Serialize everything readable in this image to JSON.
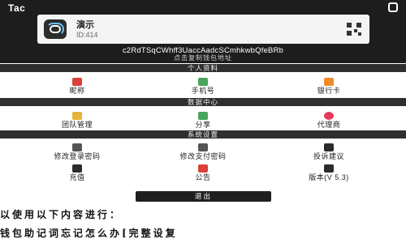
{
  "app": {
    "brand": "Tac"
  },
  "profile": {
    "name": "演示",
    "id": "ID:414",
    "address": "c2RdTSqCWhff3UaccAadcSCmhkwbQfeBRb",
    "address_hint": "点击复制钱包地址"
  },
  "sections": {
    "personal": {
      "title": "个人资料",
      "items": [
        {
          "label": "昵称",
          "icon": "id-card-icon",
          "color": "#d9423b"
        },
        {
          "label": "手机号",
          "icon": "phone-icon",
          "color": "#4ba45c"
        },
        {
          "label": "银行卡",
          "icon": "card-icon",
          "color": "#f08a2a"
        }
      ]
    },
    "data_center": {
      "title": "数据中心",
      "items": [
        {
          "label": "团队管理",
          "icon": "crown-icon",
          "color": "#e8b33a"
        },
        {
          "label": "分享",
          "icon": "share-icon",
          "color": "#4ba45c"
        },
        {
          "label": "代理商",
          "icon": "heart-icon",
          "color": "#e53a5e"
        }
      ]
    },
    "settings": {
      "title": "系统设置",
      "items": [
        {
          "label": "修改登录密码",
          "icon": "lock-icon",
          "color": "#555555"
        },
        {
          "label": "修改支付密码",
          "icon": "lock-icon",
          "color": "#555555"
        },
        {
          "label": "投诉建议",
          "icon": "feedback-icon",
          "color": "#2b2b2b"
        },
        {
          "label": "充值",
          "icon": "wallet-icon",
          "color": "#2b2b2b"
        },
        {
          "label": "公告",
          "icon": "bell-icon",
          "color": "#d9423b"
        },
        {
          "label": "版本(V 5.3)",
          "icon": "upload-icon",
          "color": "#2b2b2b"
        }
      ]
    }
  },
  "logout_label": "退出",
  "footer": {
    "line1": "以使用以下内容进行：",
    "line2": "钱包助记词忘记怎么办[完整设复"
  }
}
